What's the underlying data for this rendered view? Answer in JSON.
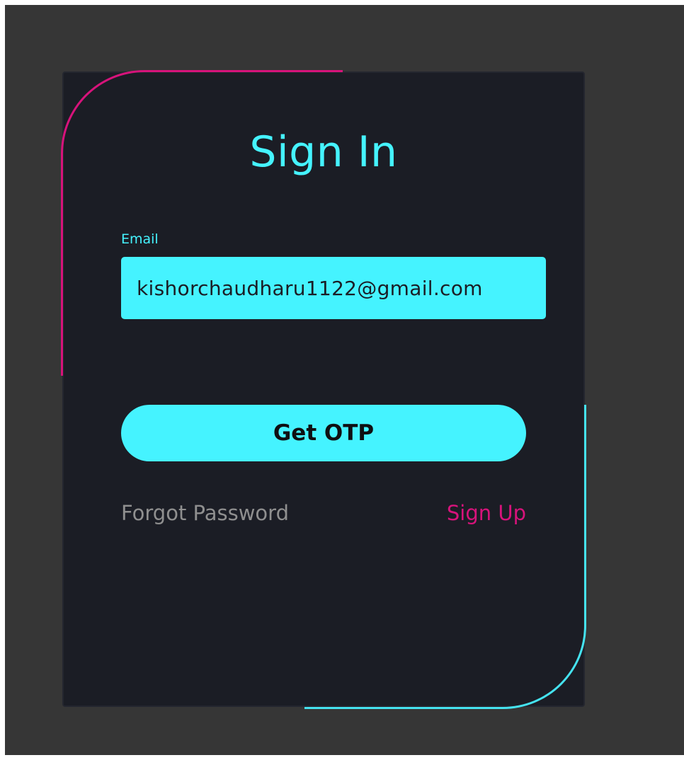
{
  "card": {
    "title": "Sign In",
    "email": {
      "label": "Email",
      "value": "kishorchaudharu1122@gmail.com",
      "placeholder": ""
    },
    "submit_label": "Get OTP",
    "forgot_label": "Forgot Password",
    "signup_label": "Sign Up"
  },
  "colors": {
    "page_background": "#363636",
    "card_background": "#1b1d25",
    "primary_cyan": "#45f3ff",
    "accent_pink": "#d7137b",
    "muted_text": "#8f8f8f"
  }
}
